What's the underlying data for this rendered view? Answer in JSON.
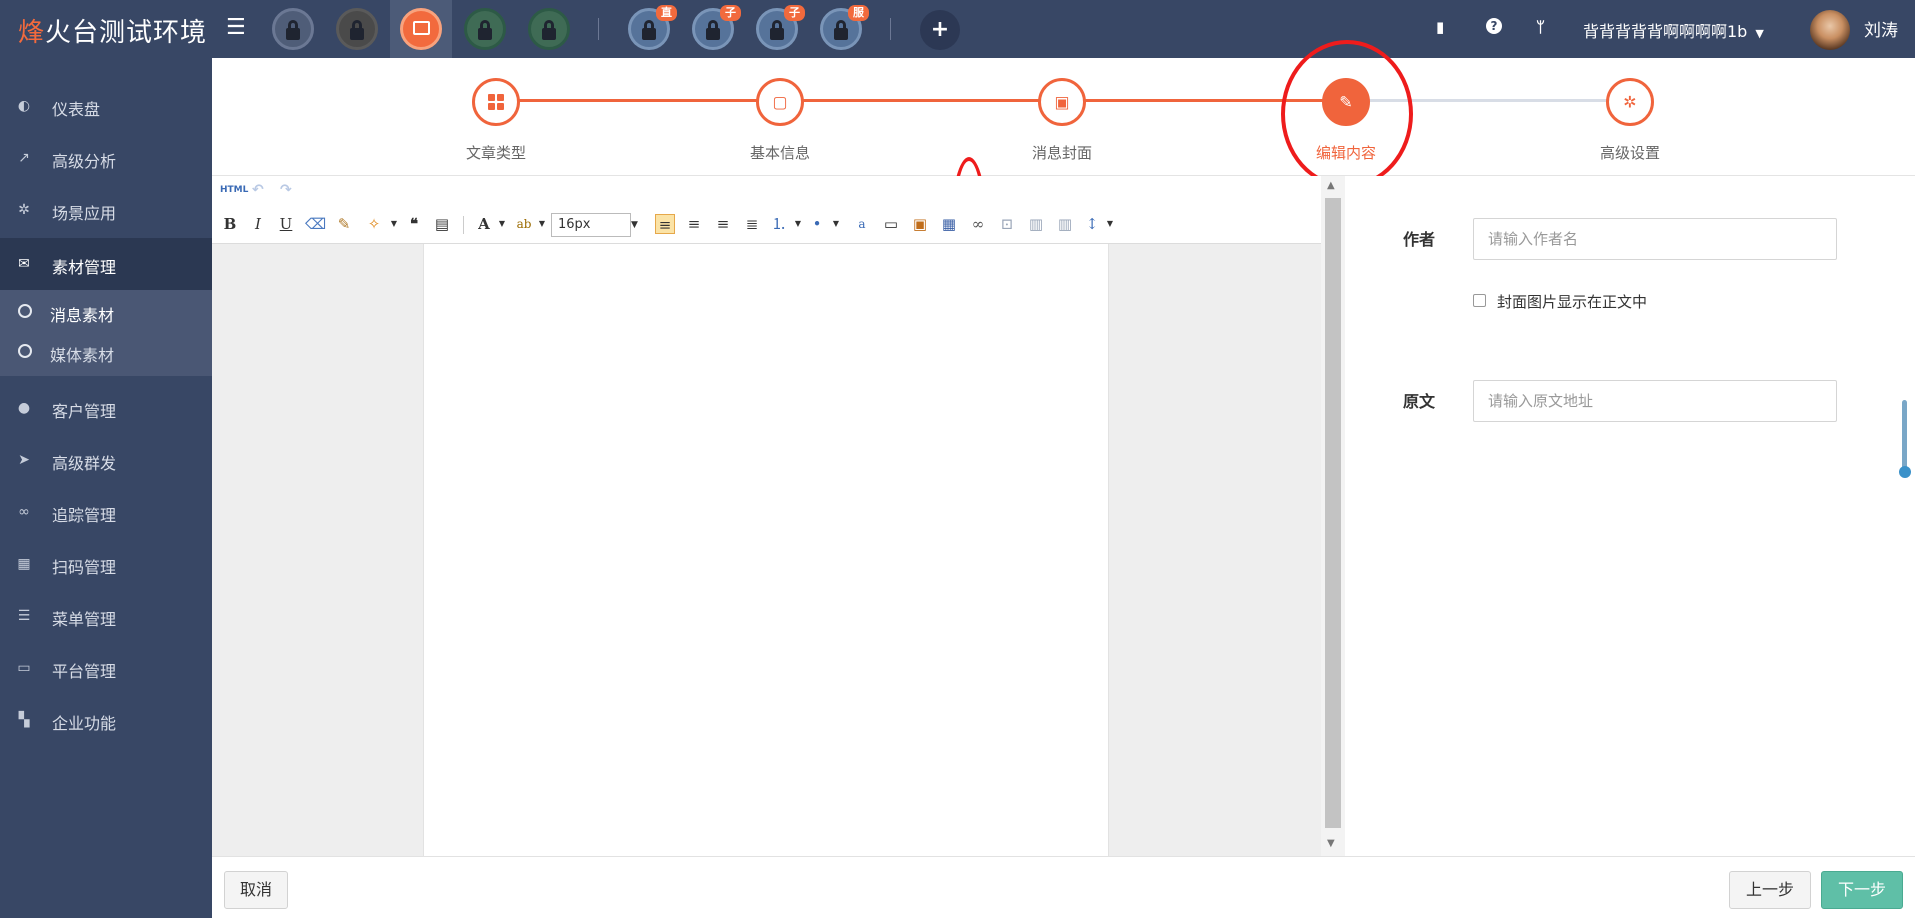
{
  "brand": {
    "accent": "烽",
    "rest": "火台测试环境"
  },
  "topbar": {
    "badges": [
      "直",
      "子",
      "子",
      "服"
    ],
    "plus_label": "+",
    "icons": [
      "book-icon",
      "question-icon",
      "fork-icon"
    ],
    "user_label": "背背背背背啊啊啊啊1b",
    "user_name": "刘涛"
  },
  "sidebar": {
    "items": [
      {
        "label": "仪表盘",
        "icon": "dashboard-icon"
      },
      {
        "label": "高级分析",
        "icon": "line-chart-icon"
      },
      {
        "label": "场景应用",
        "icon": "gear-icon"
      },
      {
        "label": "素材管理",
        "icon": "envelope-icon"
      },
      {
        "label": "客户管理",
        "icon": "user-icon"
      },
      {
        "label": "高级群发",
        "icon": "paper-plane-icon"
      },
      {
        "label": "追踪管理",
        "icon": "link-icon"
      },
      {
        "label": "扫码管理",
        "icon": "qrcode-icon"
      },
      {
        "label": "菜单管理",
        "icon": "list-icon"
      },
      {
        "label": "平台管理",
        "icon": "monitor-icon"
      },
      {
        "label": "企业功能",
        "icon": "grid-icon"
      }
    ],
    "sub_items": [
      {
        "label": "消息素材"
      },
      {
        "label": "媒体素材"
      }
    ]
  },
  "steps": [
    {
      "label": "文章类型",
      "icon": "grid-icon"
    },
    {
      "label": "基本信息",
      "icon": "square-icon"
    },
    {
      "label": "消息封面",
      "icon": "image-icon"
    },
    {
      "label": "编辑内容",
      "icon": "edit-icon"
    },
    {
      "label": "高级设置",
      "icon": "gear-icon"
    }
  ],
  "editor": {
    "html_label": "HTML",
    "font_size": "16px",
    "toolbar_glyphs": {
      "bold": "B",
      "italic": "I",
      "underline": "U",
      "eraser": "⌫",
      "brush": "✎",
      "magic": "✧",
      "quote": "❝",
      "paste": "▤",
      "font_color": "A",
      "bg_color": "ab",
      "align_left": "≡",
      "align_center": "≡",
      "align_right": "≡",
      "justify": "≣",
      "ol": "⒈",
      "ul": "•",
      "anchor": "a",
      "page": "▭",
      "image": "▣",
      "video": "▦",
      "link": "∞",
      "unlink": "⊡",
      "table": "▥",
      "table2": "▥",
      "lineheight": "↕"
    }
  },
  "form": {
    "author_label": "作者",
    "author_placeholder": "请输入作者名",
    "checkbox_label": "封面图片显示在正文中",
    "source_label": "原文",
    "source_placeholder": "请输入原文地址"
  },
  "buttons": {
    "cancel": "取消",
    "prev": "上一步",
    "next": "下一步"
  },
  "colors": {
    "accent": "#f0643c",
    "topbar": "#384765",
    "next_button": "#5fbfa7",
    "annotation": "#ee1c1c"
  }
}
